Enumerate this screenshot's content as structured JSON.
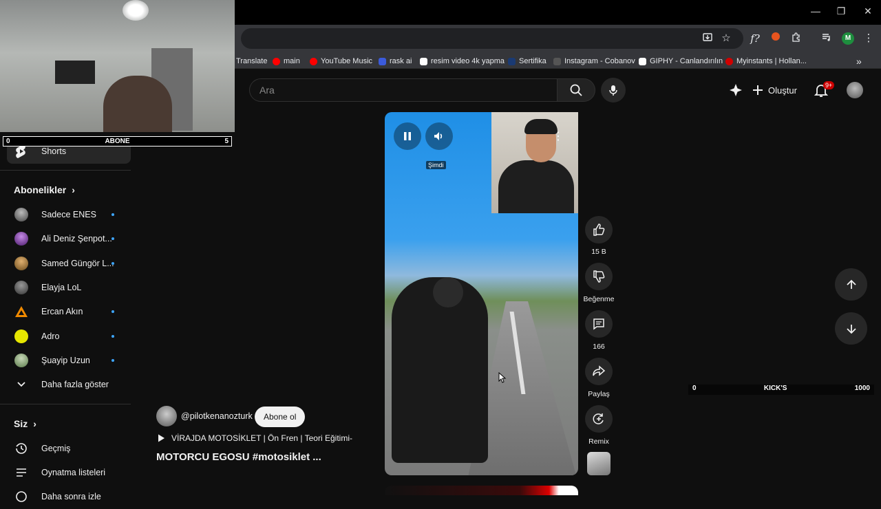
{
  "browser": {
    "window_controls": [
      "—",
      "❐",
      "✕"
    ],
    "profile_initial": "M",
    "bookmarks": [
      {
        "label": "Translate",
        "color": "#4285f4"
      },
      {
        "label": "main",
        "color": "#ff0000"
      },
      {
        "label": "YouTube Music",
        "color": "#ff0000"
      },
      {
        "label": "rask ai",
        "color": "#3b5bdb"
      },
      {
        "label": "resim video 4k yapma",
        "color": "#ffffff"
      },
      {
        "label": "Sertifika",
        "color": "#1a73e8"
      },
      {
        "label": "Instagram - Cobanov",
        "color": "#555555"
      },
      {
        "label": "GIPHY - Canlandırılın",
        "color": "#ffffff"
      },
      {
        "label": "Myinstants | Hollan...",
        "color": "#d00000"
      }
    ],
    "more_bookmarks": "»"
  },
  "header": {
    "search_placeholder": "Ara",
    "create_label": "Oluştur",
    "notification_badge": "9+"
  },
  "overlay": {
    "abone_bar": {
      "left": "0",
      "center": "ABONE",
      "right": "5"
    },
    "kick_bar": {
      "left": "0",
      "center": "KICK'S",
      "right": "1000"
    }
  },
  "sidebar": {
    "shorts_label": "Shorts",
    "subscriptions_title": "Abonelikler",
    "channels": [
      {
        "name": "Sadece ENES",
        "avatar_color": "#444444",
        "new": true
      },
      {
        "name": "Ali Deniz Şenpot...",
        "avatar_color": "#6a2a8a",
        "new": true
      },
      {
        "name": "Samed Güngör L...",
        "avatar_color": "#8a6a2a",
        "new": true
      },
      {
        "name": "Elayja LoL",
        "avatar_color": "#555555",
        "new": false
      },
      {
        "name": "Ercan Akın",
        "avatar_color": "#f08a00",
        "new": true
      },
      {
        "name": "Adro",
        "avatar_color": "#e6e600",
        "new": true
      },
      {
        "name": "Şuayip Uzun",
        "avatar_color": "#7a9a6a",
        "new": true
      }
    ],
    "show_more_label": "Daha fazla göster",
    "you_title": "Siz",
    "you_items": [
      "Geçmiş",
      "Oynatma listeleri",
      "Daha sonra izle"
    ]
  },
  "video": {
    "now_label": "Şimdi"
  },
  "actions": {
    "like_count": "15 B",
    "dislike_label": "Beğenme",
    "comment_count": "166",
    "share_label": "Paylaş",
    "remix_label": "Remix"
  },
  "channel": {
    "handle": "@pilotkenanozturk",
    "subscribe_label": "Abone ol",
    "linked_video": "VİRAJDA MOTOSİKLET | Ön Fren | Teori Eğitimi-",
    "title": "MOTORCU EGOSU #motosiklet ..."
  }
}
